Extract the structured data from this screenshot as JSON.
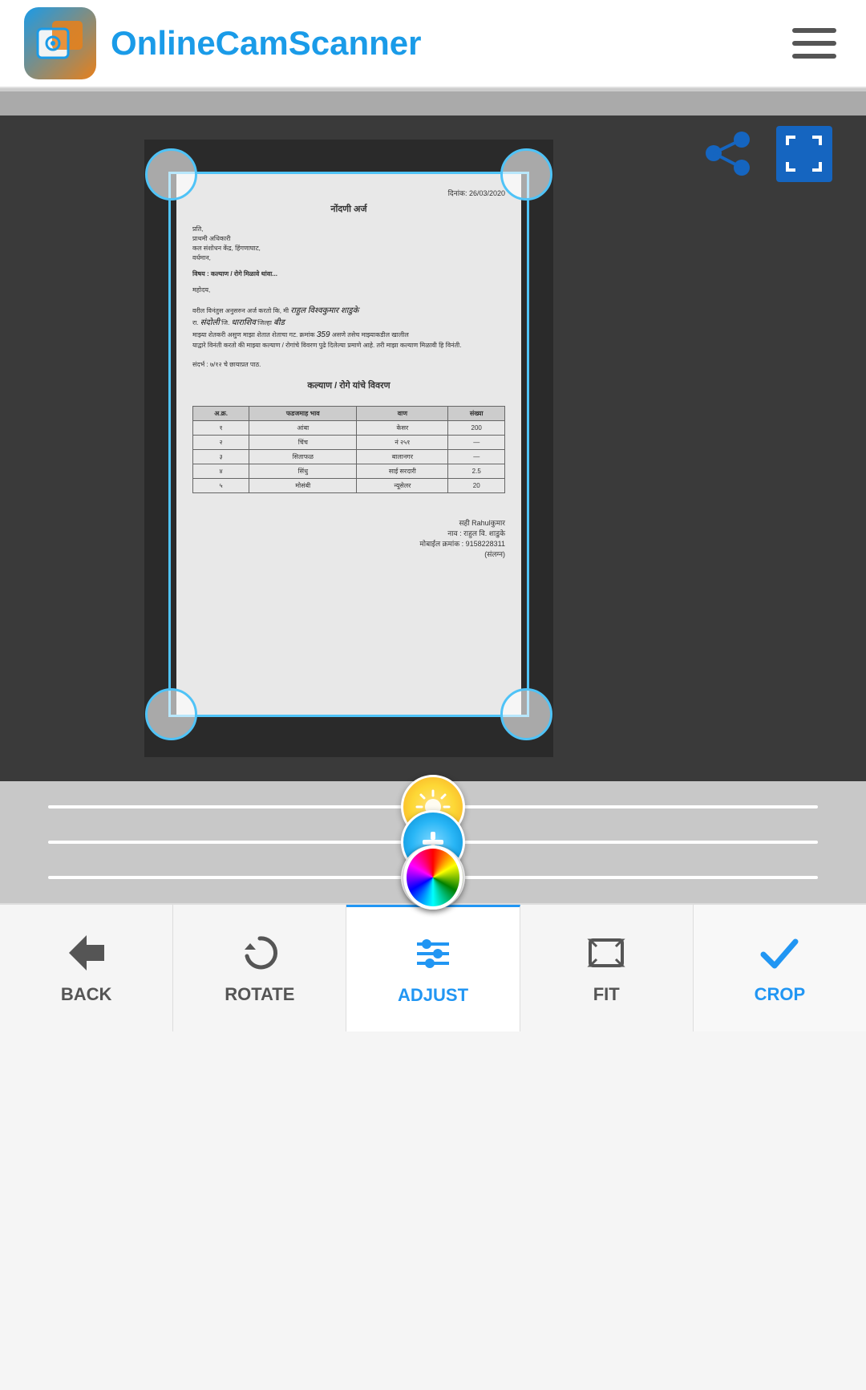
{
  "header": {
    "logo_text": "OnlineCamScanner",
    "logo_icon": "📷",
    "hamburger_label": "menu"
  },
  "top_actions": {
    "share_icon": "share",
    "fullscreen_icon": "fullscreen"
  },
  "document": {
    "date": "दिनांक: 26/03/2020",
    "title": "नोंदणी अर्ज",
    "salutation": "प्रति,",
    "address1": "प्राथमी अधिकारी",
    "address2": "कल संशोधन केंद्र, हिंगणाघाट,",
    "address3": "वर्धमान,",
    "subject": "विषय : कल्याण / रोगे मिळावे थांवा...",
    "body_text": "महोदय,",
    "handwritten_name": "राहुल विश्वकुमार शाडुके",
    "handwritten_place": "संदोली",
    "handwritten_district": "धाराशिव",
    "handwritten_jilha": "बीड",
    "reg_no": "359",
    "closing_text": "याद्वारे विनंती करतो की माझ्या कल्याण / रोगांचे विवरण पुढे दिलेल्या प्रमाणे आहे. तरी माझा कल्याण मिळावी हि विनंती.",
    "ref": "संदर्भ : ७/१२ चे छायाप्रत पाठ.",
    "table_header": "कल्याण / रोगे यांचे विवरण",
    "table_cols": [
      "अ.क्र.",
      "फडजमाह भाव",
      "वाण",
      "संख्या"
    ],
    "table_rows": [
      [
        "१",
        "आंबा",
        "केसर",
        "200"
      ],
      [
        "२",
        "चिंच",
        "नं २५१",
        "—"
      ],
      [
        "३",
        "सिताफळ",
        "बालानगर",
        "—"
      ],
      [
        "४",
        "सिंधु",
        "साई सरदारी",
        "2.5"
      ],
      [
        "५",
        "मोसंबी",
        "न्यूसेलर",
        "20"
      ]
    ],
    "signature_label": "सही",
    "signature_name": "Rahulकुमार",
    "name_label": "नाव : राहुल वि. शाडुके",
    "mobile_label": "मोबाईल क्रमांक : 9158228311",
    "encl_label": "(संलग्न)"
  },
  "sliders": {
    "brightness": {
      "label": "brightness",
      "value": 50
    },
    "exposure": {
      "label": "exposure",
      "value": 50
    },
    "color": {
      "label": "color",
      "value": 50
    }
  },
  "toolbar": {
    "items": [
      {
        "id": "back",
        "label": "BACK",
        "icon": "back-arrow"
      },
      {
        "id": "rotate",
        "label": "ROTATE",
        "icon": "rotate"
      },
      {
        "id": "adjust",
        "label": "ADJUST",
        "icon": "adjust",
        "active": true
      },
      {
        "id": "fit",
        "label": "FIT",
        "icon": "fit"
      },
      {
        "id": "crop",
        "label": "CROP",
        "icon": "check"
      }
    ]
  }
}
